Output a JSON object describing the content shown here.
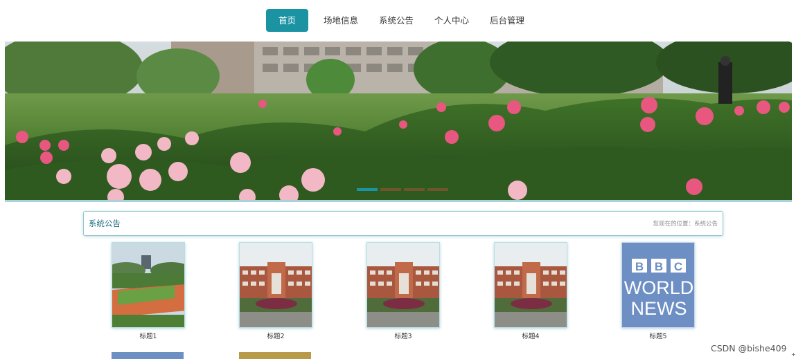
{
  "nav": {
    "items": [
      {
        "label": "首页",
        "active": true
      },
      {
        "label": "场地信息"
      },
      {
        "label": "系统公告"
      },
      {
        "label": "个人中心"
      },
      {
        "label": "后台管理"
      }
    ]
  },
  "banner": {
    "slides": 4,
    "active_slide": 1
  },
  "section": {
    "title": "系统公告",
    "breadcrumb": "您现在的位置：系统公告"
  },
  "cards": [
    {
      "caption": "标题1",
      "image": "campus-sports-field"
    },
    {
      "caption": "标题2",
      "image": "campus-building"
    },
    {
      "caption": "标题3",
      "image": "campus-building"
    },
    {
      "caption": "标题4",
      "image": "campus-building"
    },
    {
      "caption": "标题5",
      "image": "bbc-world-news-logo",
      "logo_lines": [
        "BBC",
        "WORLD",
        "NEWS"
      ]
    }
  ],
  "watermark": "CSDN @bishe409",
  "colors": {
    "accent": "#1c93a3",
    "border": "#8fc6cf",
    "bbc_blue": "#6d8fc4"
  }
}
